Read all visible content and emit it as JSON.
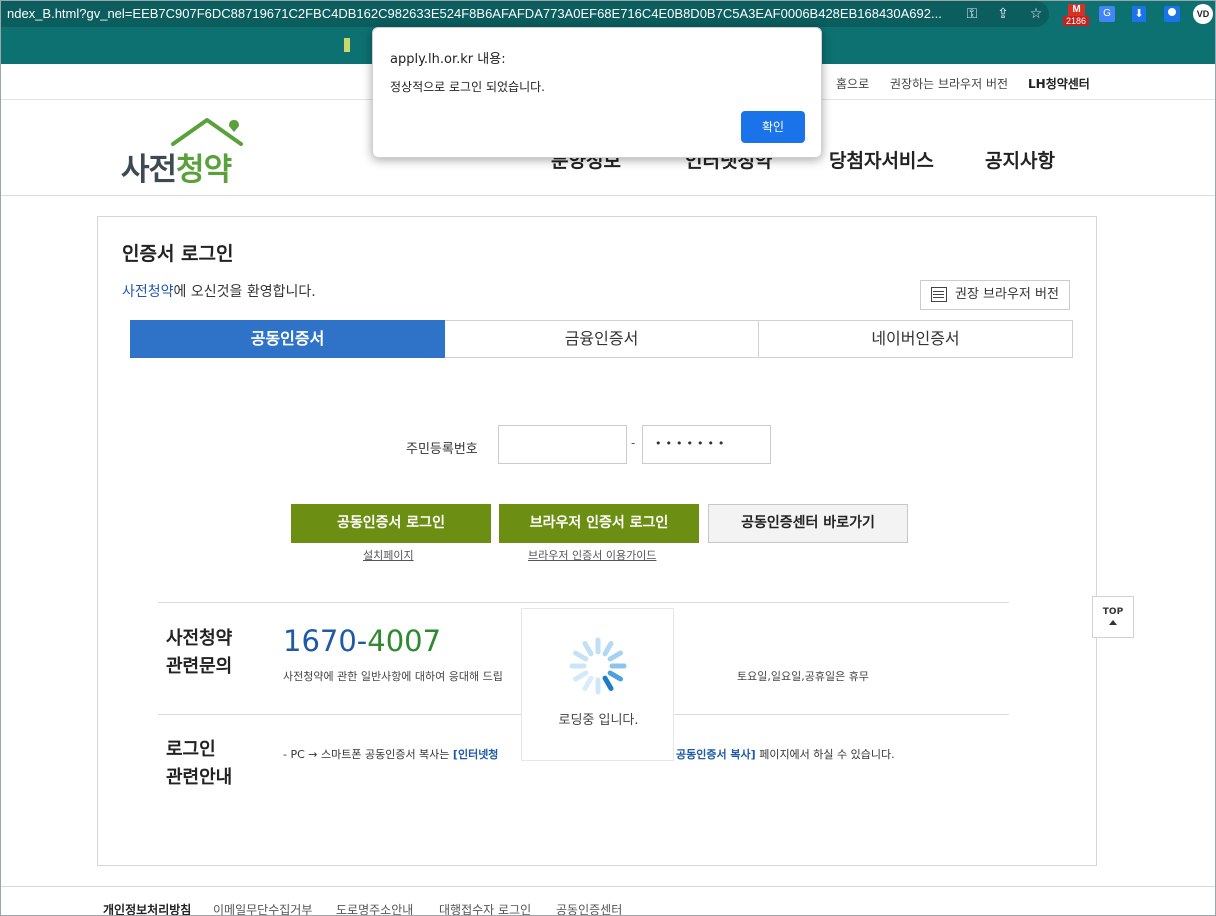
{
  "browser": {
    "url": "ndex_B.html?gv_nel=EEB7C907F6DC88719671C2FBC4DB162C982633E524F8B6AFAFDA773A0EF68E716C4E0B8D0B7C5A3EAF0006B428EB168430A692...",
    "gmail_badge": "2186",
    "profile_initials": "VD"
  },
  "util_nav": {
    "home": "홈으로",
    "browser_version": "권장하는 브라우저 버전",
    "lh_center": "LH청약센터"
  },
  "header": {
    "logo_prefix": "사전",
    "logo_suffix": "청약",
    "gnb": [
      "분양정보",
      "인터넷청약",
      "당첨자서비스",
      "공지사항"
    ]
  },
  "login": {
    "title": "인증서 로그인",
    "welcome_brand": "사전청약",
    "welcome_rest": "에 오신것을 환영합니다.",
    "browser_version_btn": "권장 브라우저 버전",
    "tabs": [
      "공동인증서",
      "금융인증서",
      "네이버인증서"
    ],
    "active_tab": 0,
    "rrn_label": "주민등록번호",
    "rrn_front": "",
    "rrn_dash": "-",
    "rrn_back_masked": "•••••••",
    "btn_cert_login": "공동인증서 로그인",
    "btn_browser_login": "브라우저 인증서 로그인",
    "btn_center": "공동인증센터 바로가기",
    "link_install": "설치페이지",
    "link_guide": "브라우저 인증서 이용가이드"
  },
  "inquiry": {
    "title_line1": "사전청약",
    "title_line2": "관련문의",
    "phone_a": "1670-",
    "phone_b": "4007",
    "desc_left": "사전청약에 관한 일반사항에 대하여 응대해 드립",
    "desc_right": "토요일,일요일,공휴일은 휴무"
  },
  "guide": {
    "title_line1": "로그인",
    "title_line2": "관련안내",
    "text_left_prefix": "- PC → 스마트폰 공동인증서 복사는 ",
    "text_left_bold": "[인터넷청",
    "text_right_bold": "공동인증서 복사]",
    "text_right_rest": " 페이지에서 하실 수 있습니다."
  },
  "loading": {
    "text": "로딩중 입니다."
  },
  "top_button": "TOP",
  "footer": [
    "개인정보처리방침",
    "이메일무단수집거부",
    "도로명주소안내",
    "대행접수자 로그인",
    "공동인증센터"
  ],
  "dialog": {
    "origin": "apply.lh.or.kr 내용:",
    "message": "정상적으로 로그인 되었습니다.",
    "ok": "확인"
  },
  "colors": {
    "brand_teal": "#0d7171",
    "tab_active": "#2f73c9",
    "green_button": "#6c8e12",
    "dialog_ok": "#1a73e8"
  }
}
